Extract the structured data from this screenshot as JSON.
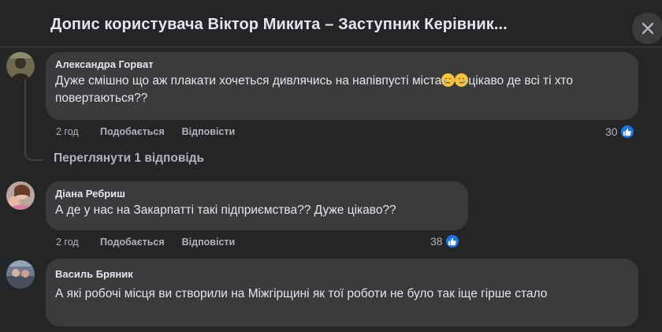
{
  "header": {
    "title": "Допис користувача Віктор Микита – Заступник Керівник..."
  },
  "comments": [
    {
      "author": "Александра Горват",
      "text_before": "Дуже смішно що аж плакати хочеться дивлячись на напівпусті міста",
      "text_after": "цікаво де всі ті хто повертаються??",
      "emojis": [
        "crying-face",
        "crying-face"
      ],
      "time": "2 год",
      "like_label": "Подобається",
      "reply_label": "Відповісти",
      "reaction_count": "30"
    },
    {
      "author": "Діана Ребриш",
      "text": "А де у нас на Закарпатті такі підприємства?? Дуже цікаво??",
      "time": "2 год",
      "like_label": "Подобається",
      "reply_label": "Відповісти",
      "reaction_count": "38"
    },
    {
      "author": "Василь Бряник",
      "text": "А які робочі місця ви створили на Міжгірщині як тої роботи не було так іще гірше стало"
    }
  ],
  "thread": {
    "view_replies_label": "Переглянути 1 відповідь"
  },
  "colors": {
    "background": "#242526",
    "bubble": "#3a3b3c",
    "text": "#e4e6eb",
    "muted": "#b0b3b8",
    "like_blue": "#1b74e4"
  },
  "icons": {
    "close": "close-icon",
    "like": "thumbs-up-icon"
  }
}
